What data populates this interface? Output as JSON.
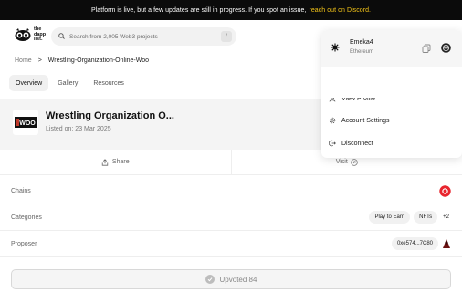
{
  "banner": {
    "text": "Platform is live, but a few updates are still in progress. If you spot an issue,",
    "link": "reach out on Discord."
  },
  "header": {
    "logo_text_1": "the",
    "logo_text_2": "dapp",
    "logo_text_3": "list.",
    "search_placeholder": "Search from 2,005 Web3 projects",
    "search_shortcut": "/"
  },
  "breadcrumb": {
    "home": "Home",
    "separator": ">",
    "current": "Wrestling-Organization-Online-Woo"
  },
  "tabs": [
    {
      "label": "Overview"
    },
    {
      "label": "Gallery"
    },
    {
      "label": "Resources"
    }
  ],
  "project": {
    "title": "Wrestling Organization O...",
    "listed": "Listed on: 23 Mar 2025",
    "logo_text": "WOO"
  },
  "actions": {
    "share": "Share",
    "visit": "Visit"
  },
  "details": {
    "chains_label": "Chains",
    "categories_label": "Categories",
    "categories": [
      "Play to Earn",
      "NFTs"
    ],
    "categories_more": "+2",
    "proposer_label": "Proposer",
    "proposer_address": "0xe574...7C80"
  },
  "upvote": {
    "label": "Upvoted 84"
  },
  "account_menu": {
    "name": "Emeka4",
    "chain": "Ethereum",
    "items": [
      "View Profile",
      "Account Settings",
      "Disconnect"
    ]
  },
  "colors": {
    "banner_bg": "#0b0b0b",
    "banner_link": "#f5c518",
    "chain_badge": "#e8252e",
    "hero_bg": "#f4f4f4"
  }
}
